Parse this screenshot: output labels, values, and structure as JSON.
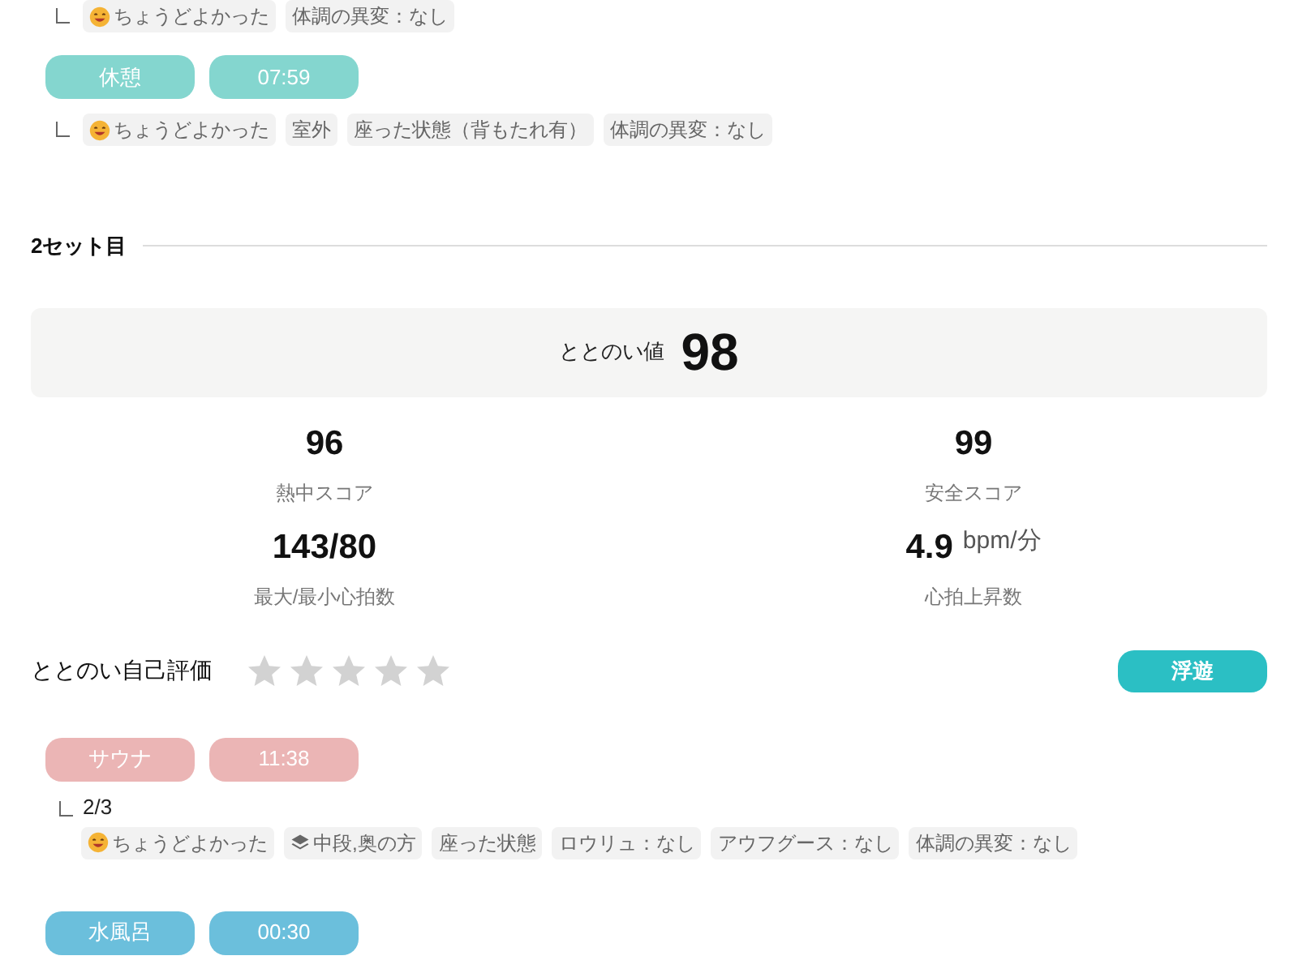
{
  "previous_tags": [
    {
      "kind": "smiley",
      "text": "ちょうどよかった"
    },
    {
      "kind": "plain",
      "text": "体調の異変：なし"
    }
  ],
  "sessions_before": [
    {
      "kind": "rest",
      "label": "休憩",
      "time": "07:59",
      "tags": [
        {
          "kind": "smiley",
          "text": "ちょうどよかった"
        },
        {
          "kind": "plain",
          "text": "室外"
        },
        {
          "kind": "plain",
          "text": "座った状態（背もたれ有）"
        },
        {
          "kind": "plain",
          "text": "体調の異変：なし"
        }
      ]
    }
  ],
  "section": {
    "title": "2セット目"
  },
  "totonoi": {
    "label": "ととのい値",
    "value": "98"
  },
  "stats": [
    {
      "value": "96",
      "label": "熱中スコア"
    },
    {
      "value": "99",
      "label": "安全スコア"
    },
    {
      "value": "143/80",
      "label": "最大/最小心拍数"
    },
    {
      "value": "4.9",
      "unit": "bpm/分",
      "label": "心拍上昇数"
    }
  ],
  "self_rating": {
    "label": "ととのい自己評価",
    "stars": 0,
    "badge": "浮遊"
  },
  "sessions": [
    {
      "kind": "sauna",
      "label": "サウナ",
      "time": "11:38",
      "sub": "2/3",
      "tags": [
        {
          "kind": "smiley",
          "text": "ちょうどよかった"
        },
        {
          "kind": "layers",
          "text": "中段,奥の方"
        },
        {
          "kind": "plain",
          "text": "座った状態"
        },
        {
          "kind": "plain",
          "text": "ロウリュ：なし"
        },
        {
          "kind": "plain",
          "text": "アウフグース：なし"
        },
        {
          "kind": "plain",
          "text": "体調の異変：なし"
        }
      ]
    },
    {
      "kind": "water",
      "label": "水風呂",
      "time": "00:30"
    }
  ]
}
